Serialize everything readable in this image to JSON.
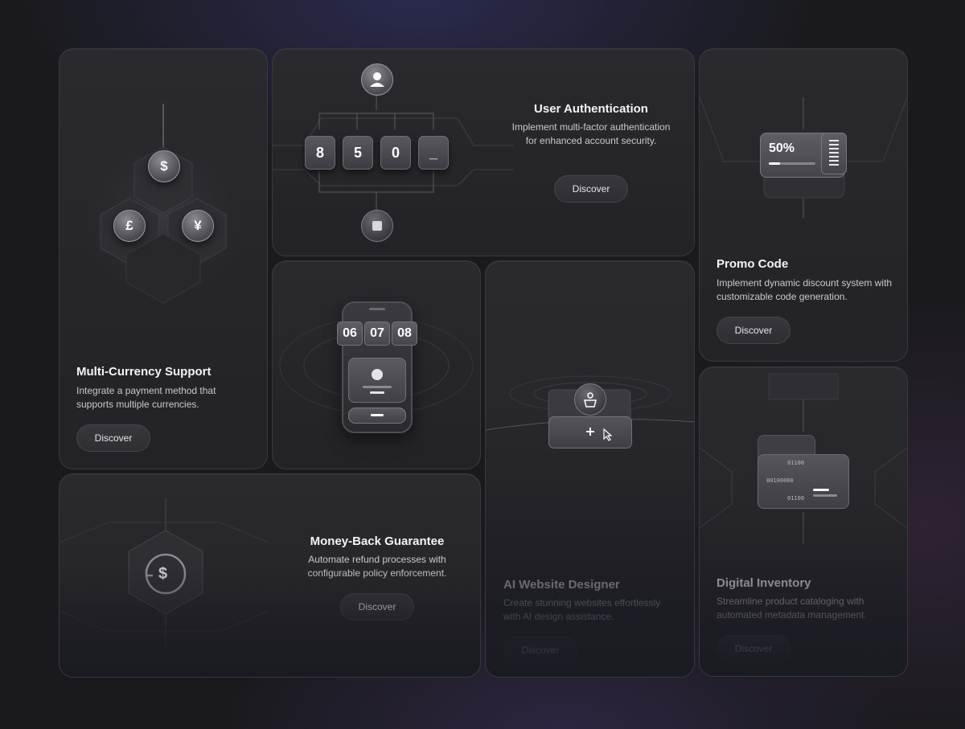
{
  "cards": {
    "multi_currency": {
      "title": "Multi-Currency Support",
      "desc": "Integrate a payment method that supports multiple currencies.",
      "button": "Discover",
      "symbols": {
        "dollar": "$",
        "pound": "£",
        "yen": "¥"
      }
    },
    "user_auth": {
      "title": "User Authentication",
      "desc": "Implement multi-factor authentication for enhanced account security.",
      "button": "Discover",
      "digits": [
        "8",
        "5",
        "0",
        "_"
      ]
    },
    "promo_code": {
      "title": "Promo Code",
      "desc": "Implement dynamic discount system with customizable code generation.",
      "button": "Discover",
      "discount": "50%"
    },
    "countdown": {
      "time": [
        "06",
        "07",
        "08"
      ]
    },
    "ai_designer": {
      "title": "AI Website Designer",
      "desc": "Create stunning websites effortlessly with AI design assistance.",
      "button": "Discover"
    },
    "digital_inventory": {
      "title": "Digital Inventory",
      "desc": "Streamline product cataloging with automated metadata management.",
      "button": "Discover",
      "binary": [
        "01100",
        "00100000",
        "01100"
      ]
    },
    "money_back": {
      "title": "Money-Back Guarantee",
      "desc": "Automate refund processes with configurable policy enforcement.",
      "button": "Discover",
      "symbol": "$"
    }
  },
  "colors": {
    "background": "#1a1a1e",
    "card": "#2a2a2e",
    "accent": "#f4f4f6"
  }
}
